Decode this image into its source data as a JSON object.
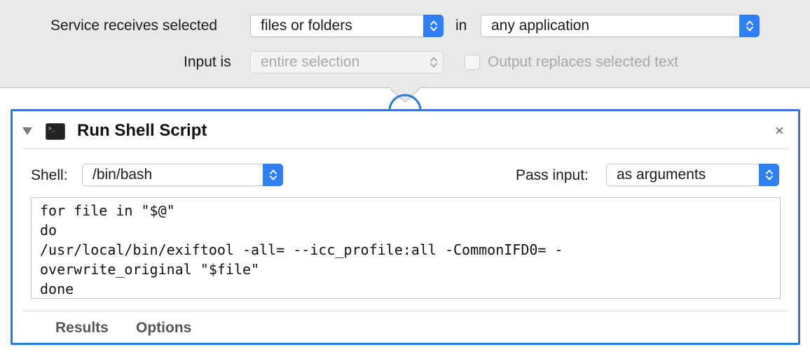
{
  "header": {
    "service_receives_label": "Service receives selected",
    "service_type_value": "files or folders",
    "in_label": "in",
    "application_value": "any application",
    "input_is_label": "Input is",
    "input_scope_value": "entire selection",
    "output_replaces_label": "Output replaces selected text"
  },
  "action": {
    "title": "Run Shell Script",
    "close_glyph": "×",
    "shell_label": "Shell:",
    "shell_value": "/bin/bash",
    "pass_input_label": "Pass input:",
    "pass_input_value": "as arguments",
    "script_lines": [
      "for file in \"$@\"",
      "do",
      "/usr/local/bin/exiftool -all= --icc_profile:all -CommonIFD0= -",
      "overwrite_original \"$file\"",
      "done"
    ],
    "tabs": [
      "Results",
      "Options"
    ]
  },
  "colors": {
    "accent": "#2f7ff2",
    "action_border": "#2a7ad6",
    "header_bg": "#e9e9e9"
  },
  "icons": {
    "disclosure": "disclosure-triangle-icon",
    "action": "terminal-icon",
    "close": "close-icon",
    "popup": "updown-chevron-icon"
  }
}
